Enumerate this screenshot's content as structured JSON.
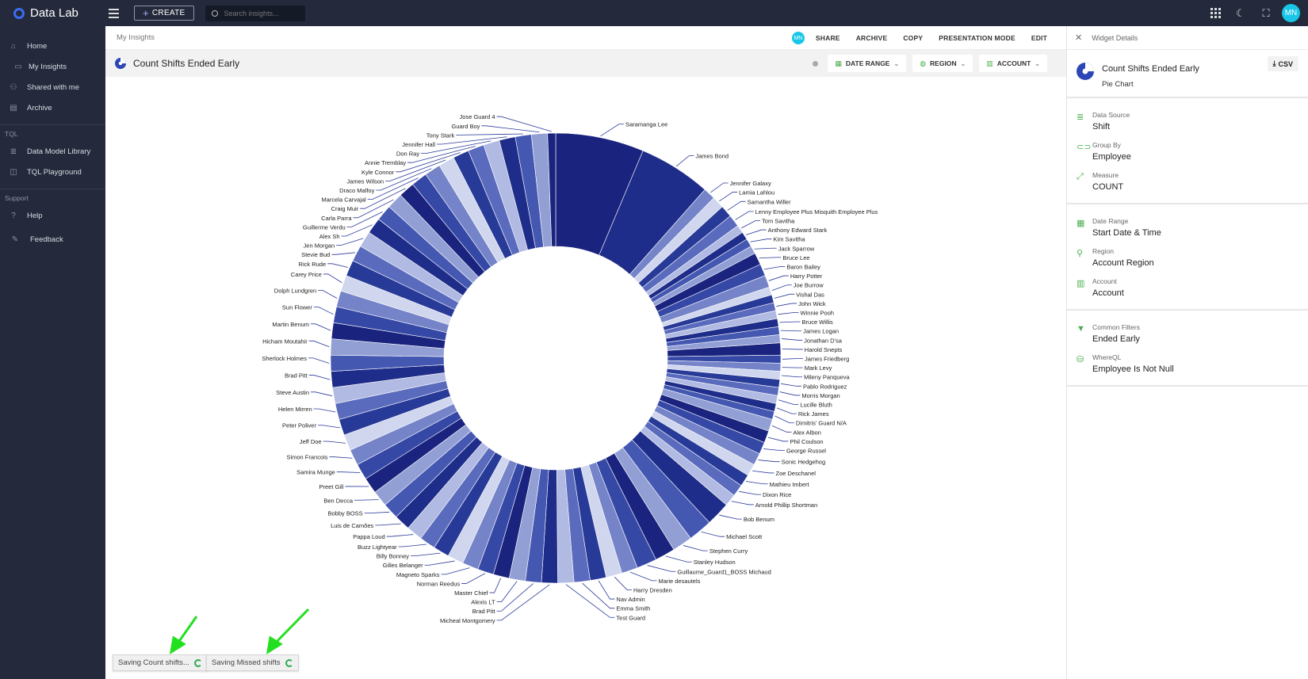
{
  "app": {
    "name": "Data Lab",
    "user_initials": "MN"
  },
  "topbar": {
    "create_label": "CREATE",
    "search_placeholder": "Search insights..."
  },
  "sidebar": {
    "items": [
      {
        "label": "Home",
        "icon": "home-icon"
      },
      {
        "label": "My Insights",
        "icon": "folder-icon"
      },
      {
        "label": "Shared with me",
        "icon": "people-icon"
      },
      {
        "label": "Archive",
        "icon": "archive-icon"
      }
    ],
    "tql_section": "TQL",
    "tql_items": [
      {
        "label": "Data Model Library",
        "icon": "database-icon"
      },
      {
        "label": "TQL Playground",
        "icon": "playground-icon"
      }
    ],
    "support_section": "Support",
    "support_items": [
      {
        "label": "Help",
        "icon": "help-icon"
      },
      {
        "label": "Feedback",
        "icon": "feedback-icon"
      }
    ]
  },
  "breadcrumb": "My Insights",
  "actions": {
    "share": "SHARE",
    "archive": "ARCHIVE",
    "copy": "COPY",
    "presentation": "PRESENTATION MODE",
    "edit": "EDIT"
  },
  "widget": {
    "title": "Count Shifts Ended Early"
  },
  "filters": {
    "date_range": "DATE RANGE",
    "region": "REGION",
    "account": "ACCOUNT"
  },
  "toasts": [
    {
      "label": "Saving Count shifts..."
    },
    {
      "label": "Saving Missed shifts"
    }
  ],
  "panel": {
    "header": "Widget Details",
    "title": "Count Shifts Ended Early",
    "chart_type": "Pie Chart",
    "csv_label": "CSV",
    "rows": [
      {
        "label": "Data Source",
        "value": "Shift",
        "icon": "database-icon"
      },
      {
        "label": "Group By",
        "value": "Employee",
        "icon": "link-icon"
      },
      {
        "label": "Measure",
        "value": "COUNT",
        "icon": "expand-icon"
      },
      {
        "label": "Date Range",
        "value": "Start Date & Time",
        "icon": "calendar-icon"
      },
      {
        "label": "Region",
        "value": "Account Region",
        "icon": "location-icon"
      },
      {
        "label": "Account",
        "value": "Account",
        "icon": "building-icon"
      },
      {
        "label": "Common Filters",
        "value": "Ended Early",
        "icon": "filter-icon"
      },
      {
        "label": "WhereQL",
        "value": "Employee Is Not Null",
        "icon": "whereql-icon"
      }
    ]
  },
  "colors": {
    "accent": "#1f2d86",
    "topbar": "#242a3b",
    "green": "#4caf50",
    "avatar": "#18c6e8"
  },
  "chart_data": {
    "type": "pie",
    "donut": true,
    "categories": [
      "Saramanga Lee",
      "James Bond",
      "Jennifer Galaxy",
      "Lamia Lahlou",
      "Samantha Willer",
      "Lenny Employee Plus Misquith Employee Plus",
      "Tom Savitha",
      "Anthony Edward Stark",
      "Kim Savitha",
      "Jack Sparrow",
      "Bruce Lee",
      "Baron Bailey",
      "Harry Potter",
      "Joe Burrow",
      "Vishal Das",
      "John Wick",
      "Winnie Pooh",
      "Bruce Willis",
      "James Logan",
      "Jonathan D'sa",
      "Harold Snepts",
      "James Friedberg",
      "Mark Levy",
      "Mileny Panqueva",
      "Pablo Rodriguez",
      "Morris Morgan",
      "Lucille Bluth",
      "Rick James",
      "Dimitris' Guard N/A",
      "Alex Albon",
      "Phil Coulson",
      "George Russel",
      "Sonic Hedgehog",
      "Zoe Deschanel",
      "Mathieu Imbert",
      "Dixon Rice",
      "Arnold Phillip Shortman",
      "Bob Benum",
      "Michael Scott",
      "Stephen Curry",
      "Stanley Hudson",
      "Guillaume_Guard1_BOSS Michaud",
      "Marie desautels",
      "Harry Dresden",
      "Nav Admin",
      "Emma Smith",
      "Test Guard",
      "Micheal Montgomery",
      "Brad Pitt",
      "Alexis LT",
      "Master Chief",
      "Norman Reedus",
      "Magneto Sparks",
      "Gilles Belanger",
      "Billy Bonney",
      "Buzz Lightyear",
      "Pappa Loud",
      "Luis de Camões",
      "Bobby BOSS",
      "Ben Decca",
      "Preet Gill",
      "Samira Munge",
      "Simon Francois",
      "Jeff Doe",
      "Peter Poliver",
      "Helen Mirren",
      "Steve Austin",
      "Brad Pitt",
      "Sherlock Holmes",
      "Hicham Moutahir",
      "Martin Benum",
      "Sun Flower",
      "Dolph Lundgren",
      "Carey Price",
      "Rick Rude",
      "Stevie Bud",
      "Jen Morgan",
      "Alex Sh",
      "Guillerme Verdu",
      "Carla Parra",
      "Craig Muir",
      "Marcela Carvajal",
      "Draco Malfoy",
      "James Wilson",
      "Kyle Connor",
      "Annie Tremblay",
      "Don Ray",
      "Jennifer Hall",
      "Tony Stark",
      "Guard Boy",
      "Jose Guard 4"
    ],
    "values": [
      22,
      18,
      3,
      3,
      3,
      3,
      2,
      2,
      2,
      2,
      3,
      3,
      3,
      2,
      2,
      2,
      2,
      2,
      2,
      2,
      3,
      2,
      2,
      2,
      2,
      2,
      2,
      2,
      2,
      3,
      3,
      3,
      3,
      3,
      3,
      3,
      3,
      6,
      6,
      5,
      5,
      5,
      4,
      4,
      4,
      4,
      4,
      4,
      4,
      4,
      4,
      4,
      4,
      4,
      4,
      4,
      4,
      4,
      4,
      4,
      4,
      4,
      4,
      4,
      4,
      4,
      4,
      4,
      4,
      4,
      4,
      4,
      4,
      4,
      4,
      4,
      4,
      4,
      4,
      4,
      4,
      4,
      4,
      4,
      4,
      4,
      4,
      4,
      4,
      4,
      2
    ]
  }
}
